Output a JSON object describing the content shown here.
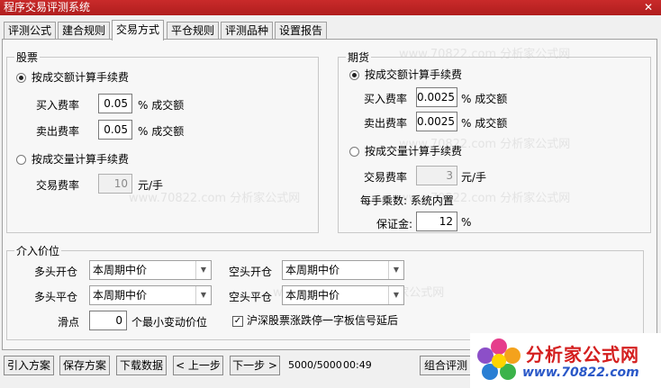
{
  "window": {
    "title": "程序交易评测系统",
    "close": "✕"
  },
  "tabs": [
    "评测公式",
    "建合规则",
    "交易方式",
    "平仓规则",
    "评测品种",
    "设置报告"
  ],
  "stock": {
    "title": "股票",
    "by_amount": "按成交额计算手续费",
    "buy_label": "买入费率",
    "buy_value": "0.05",
    "buy_unit": "% 成交额",
    "sell_label": "卖出费率",
    "sell_value": "0.05",
    "sell_unit": "% 成交额",
    "by_volume": "按成交量计算手续费",
    "trade_label": "交易费率",
    "trade_value": "10",
    "trade_unit": "元/手"
  },
  "futures": {
    "title": "期货",
    "by_amount": "按成交额计算手续费",
    "buy_label": "买入费率",
    "buy_value": "0.0025",
    "buy_unit": "% 成交额",
    "sell_label": "卖出费率",
    "sell_value": "0.0025",
    "sell_unit": "% 成交额",
    "by_volume": "按成交量计算手续费",
    "trade_label": "交易费率",
    "trade_value": "3",
    "trade_unit": "元/手",
    "multiplier_text": "每手乘数: 系统内置",
    "margin_label": "保证金:",
    "margin_value": "12",
    "margin_unit": "%"
  },
  "entry": {
    "title": "介入价位",
    "long_open_label": "多头开仓",
    "long_open_value": "本周期中价",
    "short_open_label": "空头开仓",
    "short_open_value": "本周期中价",
    "long_close_label": "多头平仓",
    "long_close_value": "本周期中价",
    "short_close_label": "空头平仓",
    "short_close_value": "本周期中价",
    "slippage_label": "滑点",
    "slippage_value": "0",
    "slippage_unit": "个最小变动价位",
    "limit_checkbox_label": "沪深股票涨跌停一字板信号延后"
  },
  "bottom": {
    "import": "引入方案",
    "save": "保存方案",
    "download": "下载数据",
    "prev": "< 上一步",
    "next": "下一步 >",
    "progress": "5000/5000",
    "time": "00:49",
    "combo": "组合评测"
  },
  "logo": {
    "text": "分析家公式网",
    "url": "www.70822.com"
  },
  "watermarks": [
    "www.70822.com 分析家公式网"
  ],
  "colors": {
    "titlebar": "#c02424",
    "logo_text": "#d41f1f",
    "logo_url": "#2a58c8"
  }
}
